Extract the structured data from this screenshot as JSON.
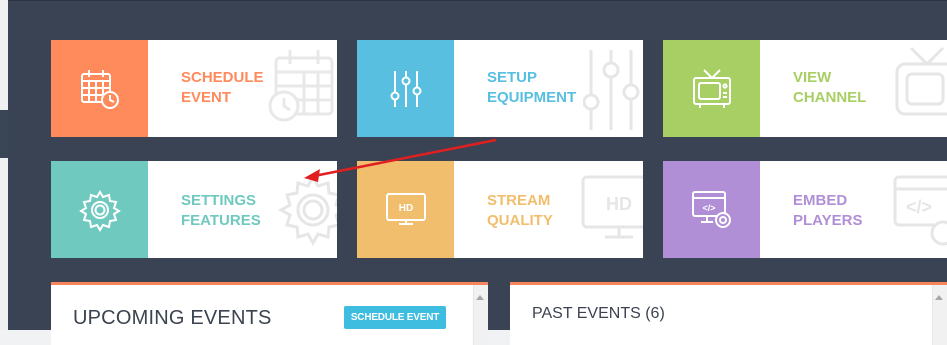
{
  "tiles": [
    {
      "id": "schedule",
      "line1": "SCHEDULE",
      "line2": "EVENT",
      "color": "#ff8a5c",
      "icon": "calendar-clock-icon"
    },
    {
      "id": "setup",
      "line1": "SETUP",
      "line2": "EQUIPMENT",
      "color": "#58bfe0",
      "icon": "sliders-icon"
    },
    {
      "id": "view",
      "line1": "VIEW",
      "line2": "CHANNEL",
      "color": "#a8cf63",
      "icon": "tv-icon"
    },
    {
      "id": "settings",
      "line1": "SETTINGS",
      "line2": "FEATURES",
      "color": "#6fc9bf",
      "icon": "gear-icon"
    },
    {
      "id": "stream",
      "line1": "STREAM",
      "line2": "QUALITY",
      "color": "#f1be6d",
      "icon": "hd-monitor-icon",
      "badge": "HD"
    },
    {
      "id": "embed",
      "line1": "EMBED",
      "line2": "PLAYERS",
      "color": "#b08fd6",
      "icon": "code-monitor-gear-icon",
      "code": "</>"
    }
  ],
  "upcoming": {
    "title": "UPCOMING EVENTS",
    "button": "SCHEDULE EVENT"
  },
  "past": {
    "title": "PAST EVENTS (6)"
  },
  "colors": {
    "panel": "#394353",
    "accent_border": "#f7855b",
    "arrow": "#e02020"
  }
}
